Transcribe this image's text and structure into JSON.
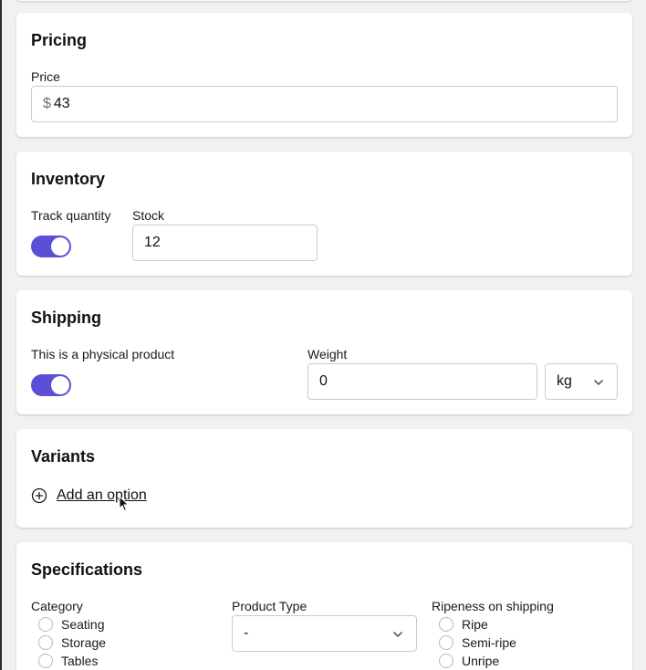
{
  "pricing": {
    "title": "Pricing",
    "price_label": "Price",
    "currency_symbol": "$",
    "price_value": "43"
  },
  "inventory": {
    "title": "Inventory",
    "track_label": "Track quantity",
    "track_enabled": true,
    "stock_label": "Stock",
    "stock_value": "12"
  },
  "shipping": {
    "title": "Shipping",
    "physical_label": "This is a physical product",
    "physical_enabled": true,
    "weight_label": "Weight",
    "weight_value": "0",
    "unit_value": "kg"
  },
  "variants": {
    "title": "Variants",
    "add_option_label": "Add an option"
  },
  "specifications": {
    "title": "Specifications",
    "category_label": "Category",
    "categories": [
      "Seating",
      "Storage",
      "Tables"
    ],
    "product_type_label": "Product Type",
    "product_type_value": "-",
    "ripeness_label": "Ripeness on shipping",
    "ripeness_options": [
      "Ripe",
      "Semi-ripe",
      "Unripe"
    ]
  },
  "colors": {
    "accent": "#5b4fd8",
    "background": "#f1f1f1",
    "card": "#ffffff"
  }
}
